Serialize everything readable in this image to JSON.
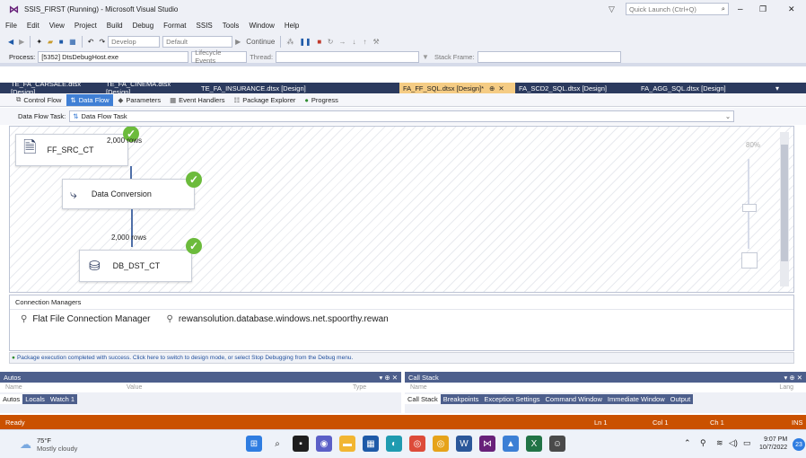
{
  "window": {
    "title": "SSIS_FIRST (Running) - Microsoft Visual Studio",
    "quick_launch": "Quick Launch (Ctrl+Q)"
  },
  "menu": [
    "File",
    "Edit",
    "View",
    "Project",
    "Build",
    "Debug",
    "Format",
    "SSIS",
    "Tools",
    "Window",
    "Help"
  ],
  "toolbar": {
    "config": "Develop",
    "platform": "Default",
    "continue": "Continue"
  },
  "toolbar2": {
    "process_label": "Process:",
    "process_value": "[5352] DtsDebugHost.exe",
    "lifecycle": "Lifecycle Events",
    "thread": "Thread:",
    "stack_frame": "Stack Frame:"
  },
  "doc_tabs": [
    {
      "label": "TE_FA_CARSALE.dtsx [Design]"
    },
    {
      "label": "TE_FA_CINEMA.dtsx [Design]"
    },
    {
      "label": "TE_FA_INSURANCE.dtsx [Design]"
    },
    {
      "label": "FA_FF_SQL.dtsx [Design]*"
    },
    {
      "label": "FA_SCD2_SQL.dtsx [Design]"
    },
    {
      "label": "FA_AGG_SQL.dtsx [Design]"
    }
  ],
  "designer_tabs": [
    "Control Flow",
    "Data Flow",
    "Parameters",
    "Event Handlers",
    "Package Explorer",
    "Progress"
  ],
  "task": {
    "label": "Data Flow Task:",
    "value": "Data Flow Task"
  },
  "nodes": {
    "source": "FF_SRC_CT",
    "conversion": "Data Conversion",
    "destination": "DB_DST_CT"
  },
  "flows": {
    "flow1": "2,000 rows",
    "flow2": "2,000 rows"
  },
  "zoom": "80%",
  "connection_managers": {
    "title": "Connection Managers",
    "items": [
      "Flat File Connection Manager",
      "rewansolution.database.windows.net.spoorthy.rewan"
    ]
  },
  "status_message": "Package execution completed with success. Click here to switch to design mode, or select Stop Debugging from the Debug menu.",
  "autos": {
    "title": "Autos",
    "col_name": "Name",
    "col_value": "Value",
    "col_type": "Type",
    "tabs": [
      "Autos",
      "Locals",
      "Watch 1"
    ]
  },
  "callstack": {
    "title": "Call Stack",
    "col_name": "Name",
    "col_lang": "Lang",
    "tabs": [
      "Call Stack",
      "Breakpoints",
      "Exception Settings",
      "Command Window",
      "Immediate Window",
      "Output"
    ]
  },
  "statusbar": {
    "ready": "Ready",
    "ln": "Ln 1",
    "col": "Col 1",
    "ch": "Ch 1",
    "ins": "INS"
  },
  "taskbar": {
    "temp": "75°F",
    "weather": "Mostly cloudy",
    "time": "9:07 PM",
    "date": "10/7/2022",
    "notif": "23"
  },
  "colors": {
    "accent": "#ca5100",
    "vs_purple": "#68217a",
    "active_tab": "#3f7fd5",
    "check": "#6cbb3c"
  }
}
